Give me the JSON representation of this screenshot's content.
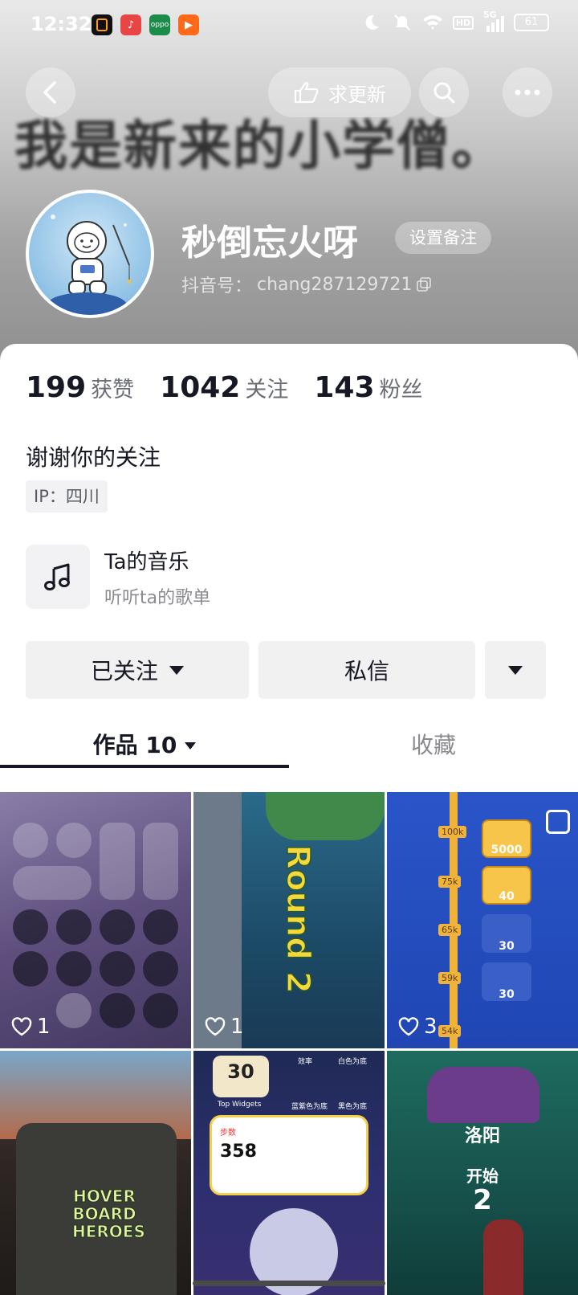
{
  "status_bar": {
    "time": "12:32",
    "battery": "61",
    "network": "5G",
    "hd": "HD"
  },
  "banner": {
    "text": "我是新来的小学僧。"
  },
  "header": {
    "update_label": "求更新"
  },
  "profile": {
    "nickname": "秒倒忘火呀",
    "remark_label": "设置备注",
    "douyin_id_label": "抖音号：",
    "douyin_id": "chang287129721"
  },
  "stats": [
    {
      "value": "199",
      "label": "获赞"
    },
    {
      "value": "1042",
      "label": "关注"
    },
    {
      "value": "143",
      "label": "粉丝"
    }
  ],
  "bio": "谢谢你的关注",
  "ip_tag": "IP：四川",
  "music": {
    "title": "Ta的音乐",
    "subtitle": "听听ta的歌单"
  },
  "actions": {
    "follow_label": "已关注",
    "message_label": "私信"
  },
  "tabs": [
    {
      "label": "作品 10"
    },
    {
      "label": "收藏"
    }
  ],
  "videos": [
    {
      "likes": "1"
    },
    {
      "likes": "1",
      "overlay": "Round 2"
    },
    {
      "likes": "3",
      "values": [
        "100k",
        "5000",
        "75k",
        "40",
        "65k",
        "30",
        "59k",
        "30",
        "54k"
      ]
    },
    {
      "likes": "",
      "overlay": "HOVER BOARD HEROES"
    },
    {
      "likes": "",
      "overlay_num": "30",
      "steps": "358",
      "labels": [
        "效率",
        "白色为底",
        "蓝紫色为底",
        "黑色为底",
        "Top Widgets",
        "步数"
      ]
    },
    {
      "likes": "",
      "overlay": "洛阳",
      "overlay2": "开始",
      "overlay3": "2"
    }
  ],
  "icons": {
    "back": "back-arrow-icon",
    "search": "search-icon",
    "more": "more-dots-icon",
    "hand": "hand-point-icon",
    "music": "music-note-icon",
    "heart": "heart-icon",
    "copy": "copy-icon"
  }
}
